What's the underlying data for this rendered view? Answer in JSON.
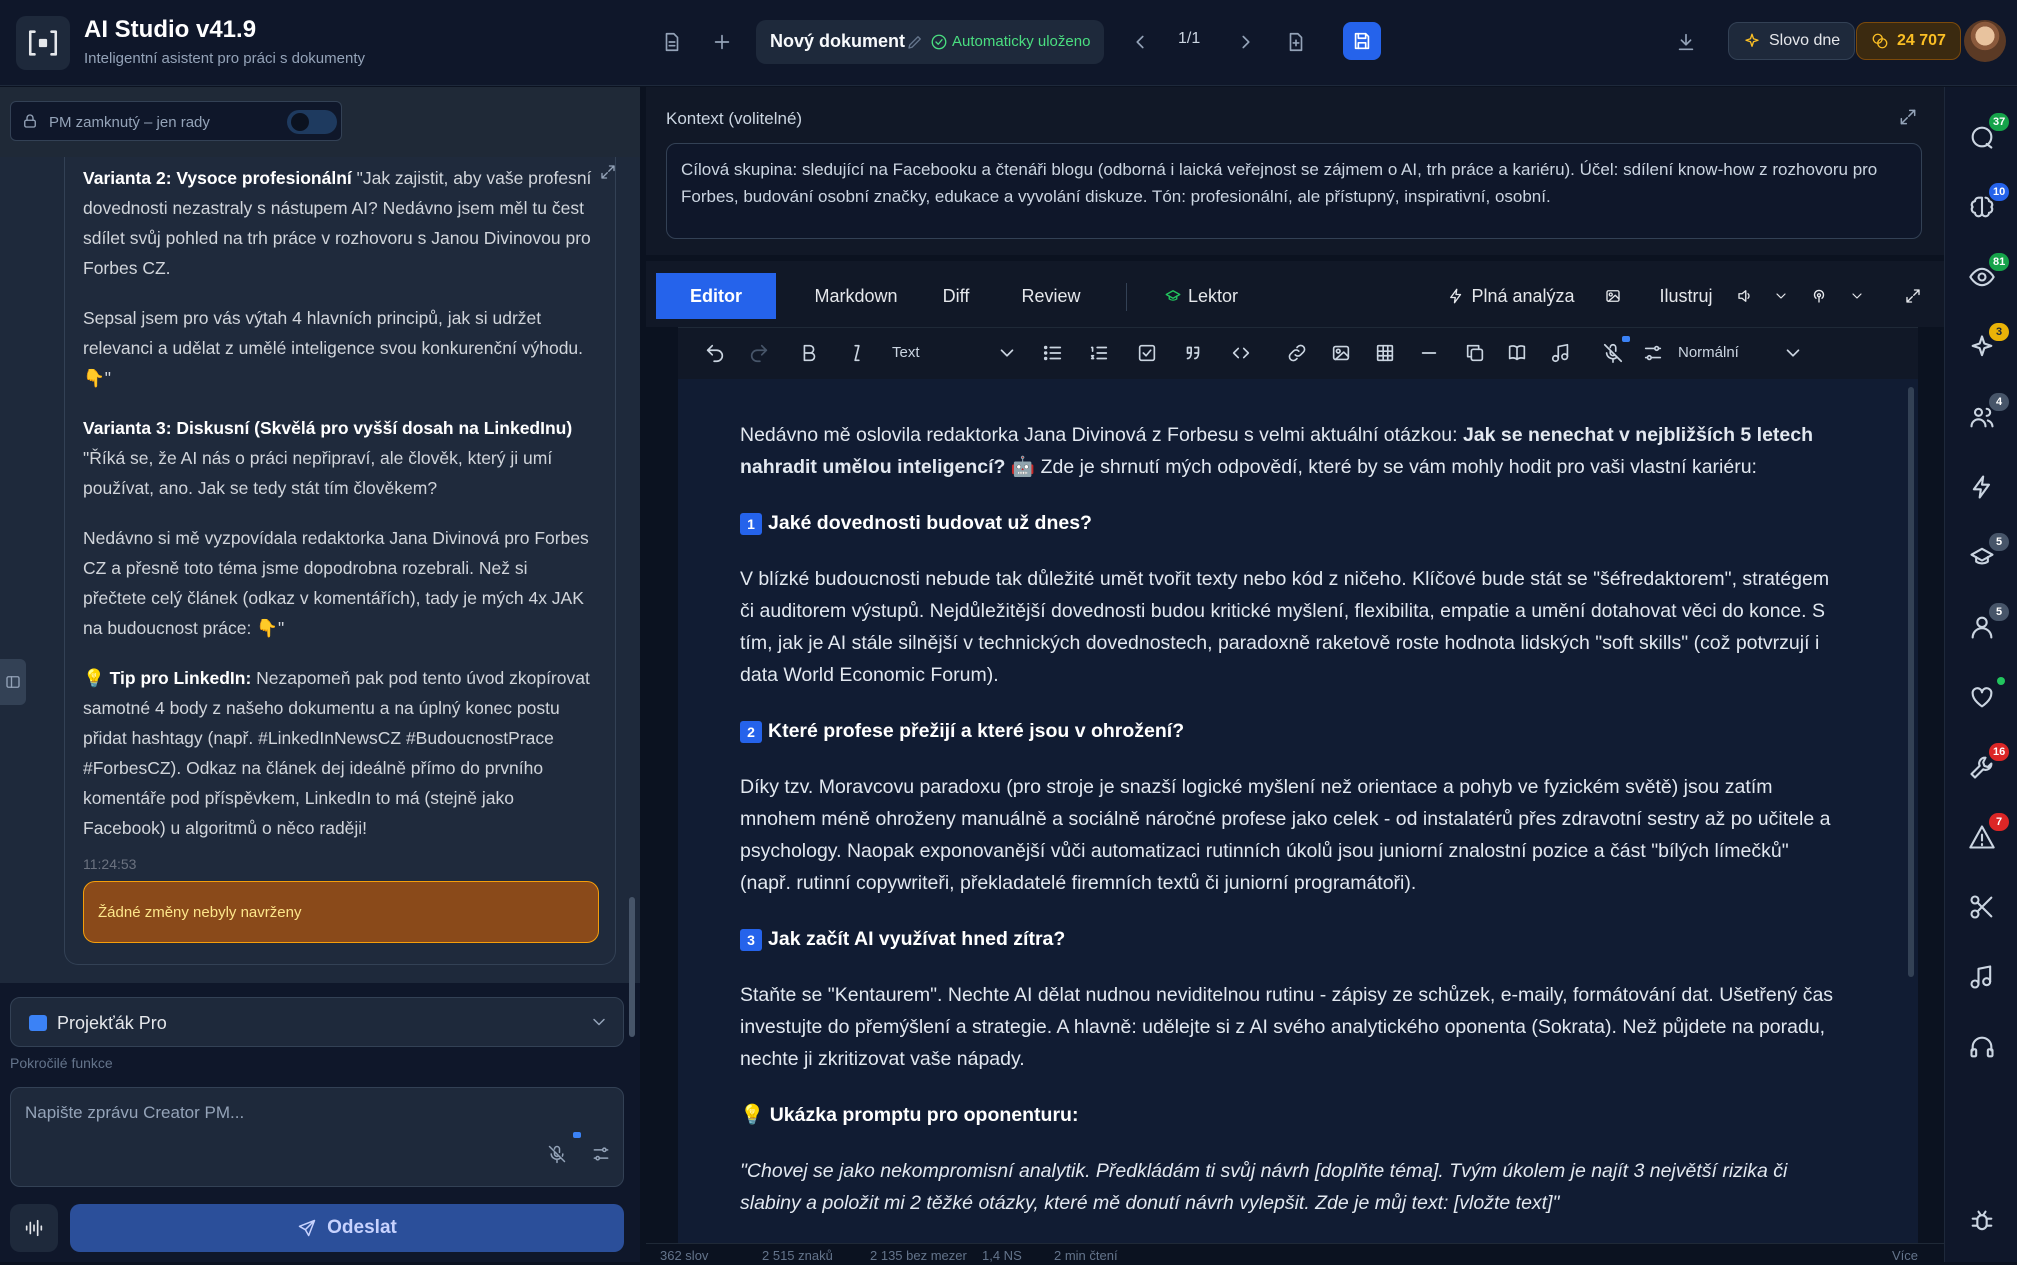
{
  "app": {
    "title": "AI Studio v41.9",
    "subtitle": "Inteligentní asistent pro práci s dokumenty"
  },
  "header": {
    "doc_name": "Nový dokument",
    "saved": "Automaticky uloženo",
    "pager": "1/1",
    "word_of_day": "Slovo dne",
    "credits": "24 707"
  },
  "left": {
    "lock_label": "PM zamknutý – jen rady",
    "message": {
      "v2_title": "Varianta 2: Vysoce profesionální",
      "v2_text": " \"Jak zajistit, aby vaše profesní dovednosti nezastraly s nástupem AI? Nedávno jsem měl tu čest sdílet svůj pohled na trh práce v rozhovoru s Janou Divinovou pro Forbes CZ.",
      "v2_p2": "Sepsal jsem pro vás výtah 4 hlavních principů, jak si udržet relevanci a udělat z umělé inteligence svou konkurenční výhodu. 👇\"",
      "v3_title": "Varianta 3: Diskusní (Skvělá pro vyšší dosah na LinkedInu)",
      "v3_text": " \"Říká se, že AI nás o práci nepřipraví, ale člověk, který ji umí používat, ano. Jak se tedy stát tím člověkem?",
      "v3_p2": "Nedávno si mě vyzpovídala redaktorka Jana Divinová pro Forbes CZ a přesně toto téma jsme dopodrobna rozebrali. Než si přečtete celý článek (odkaz v komentářích), tady je mých 4x JAK na budoucnost práce: 👇\"",
      "tip_title": "💡 Tip pro LinkedIn:",
      "tip_text": " Nezapomeň pak pod tento úvod zkopírovat samotné 4 body z našeho dokumentu a na úplný konec postu přidat hashtagy (např. #LinkedInNewsCZ #BudoucnostPrace #ForbesCZ). Odkaz na článek dej ideálně přímo do prvního komentáře pod příspěvkem, LinkedIn to má (stejně jako Facebook) u algoritmů o něco raději!",
      "time": "11:24:53",
      "no_changes": "Žádné změny nebyly navrženy"
    },
    "project": "Projekťák Pro",
    "advanced": "Pokročilé funkce",
    "compose_placeholder": "Napište zprávu Creator PM...",
    "send": "Odeslat"
  },
  "context": {
    "title": "Kontext (volitelné)",
    "text": "Cílová skupina: sledující na Facebooku a čtenáři blogu (odborná i laická veřejnost se zájmem o AI, trh práce a kariéru). Účel: sdílení know-how z rozhovoru pro Forbes, budování osobní značky, edukace a vyvolání diskuze. Tón: profesionální, ale přístupný, inspirativní, osobní."
  },
  "tabs": {
    "editor": "Editor",
    "markdown": "Markdown",
    "diff": "Diff",
    "review": "Review",
    "lektor": "Lektor",
    "analysis": "Plná analýza",
    "illustrate": "Ilustruj"
  },
  "toolbar": {
    "block_type": "Text",
    "style": "Normální"
  },
  "doc": {
    "p1a": "Nedávno mě oslovila redaktorka Jana Divinová z Forbesu s velmi aktuální otázkou: ",
    "p1b": "Jak se nenechat v nejbližších 5 letech nahradit umělou inteligencí?",
    "p1c": " 🤖 Zde je shrnutí mých odpovědí, které by se vám mohly hodit pro vaši vlastní kariéru:",
    "h1": "Jaké dovednosti budovat už dnes?",
    "n1": "1",
    "p2": "V blízké budoucnosti nebude tak důležité umět tvořit texty nebo kód z ničeho. Klíčové bude stát se \"šéfredaktorem\", stratégem či auditorem výstupů. Nejdůležitější dovednosti budou kritické myšlení, flexibilita, empatie a umění dotahovat věci do konce. S tím, jak je AI stále silnější v technických dovednostech, paradoxně raketově roste hodnota lidských \"soft skills\" (což potvrzují i data World Economic Forum).",
    "h2": "Které profese přežijí a které jsou v ohrožení?",
    "n2": "2",
    "p3": "Díky tzv. Moravcovu paradoxu (pro stroje je snazší logické myšlení než orientace a pohyb ve fyzickém světě) jsou zatím mnohem méně ohroženy manuálně a sociálně náročné profese jako celek - od instalatérů přes zdravotní sestry až po učitele a psychology. Naopak exponovanější vůči automatizaci rutinních úkolů jsou juniorní znalostní pozice a část \"bílých límečků\" (např. rutinní copywriteři, překladatelé firemních textů či juniorní programátoři).",
    "h3": "Jak začít AI využívat hned zítra?",
    "n3": "3",
    "p4": "Staňte se \"Kentaurem\". Nechte AI dělat nudnou neviditelnou rutinu - zápisy ze schůzek, e-maily, formátování dat. Ušetřený čas investujte do přemýšlení a strategie. A hlavně: udělejte si z AI svého analytického oponenta (Sokrata). Než půjdete na poradu, nechte ji zkritizovat vaše nápady.",
    "h4": "💡 Ukázka promptu pro oponenturu:",
    "p5": "\"Chovej se jako nekompromisní analytik. Předkládám ti svůj návrh [doplňte téma]. Tvým úkolem je najít 3 největší rizika či slabiny a položit mi 2 těžké otázky, které mě donutí návrh vylepšit. Zde je můj text: [vložte text]\""
  },
  "status": {
    "words": "362 slov",
    "chars": "2 515 znaků",
    "nospace": "2 135 bez mezer",
    "ns": "1,4 NS",
    "read": "2 min čtení",
    "more": "Více"
  },
  "rail": {
    "b1": "37",
    "b2": "10",
    "b3": "81",
    "b4": "3",
    "b5": "4",
    "b6": "5",
    "b7": "5",
    "b8": "16",
    "b9": "7"
  },
  "colors": {
    "accent": "#2563eb",
    "saved": "#4ade80",
    "warning": "#f59e0b"
  }
}
